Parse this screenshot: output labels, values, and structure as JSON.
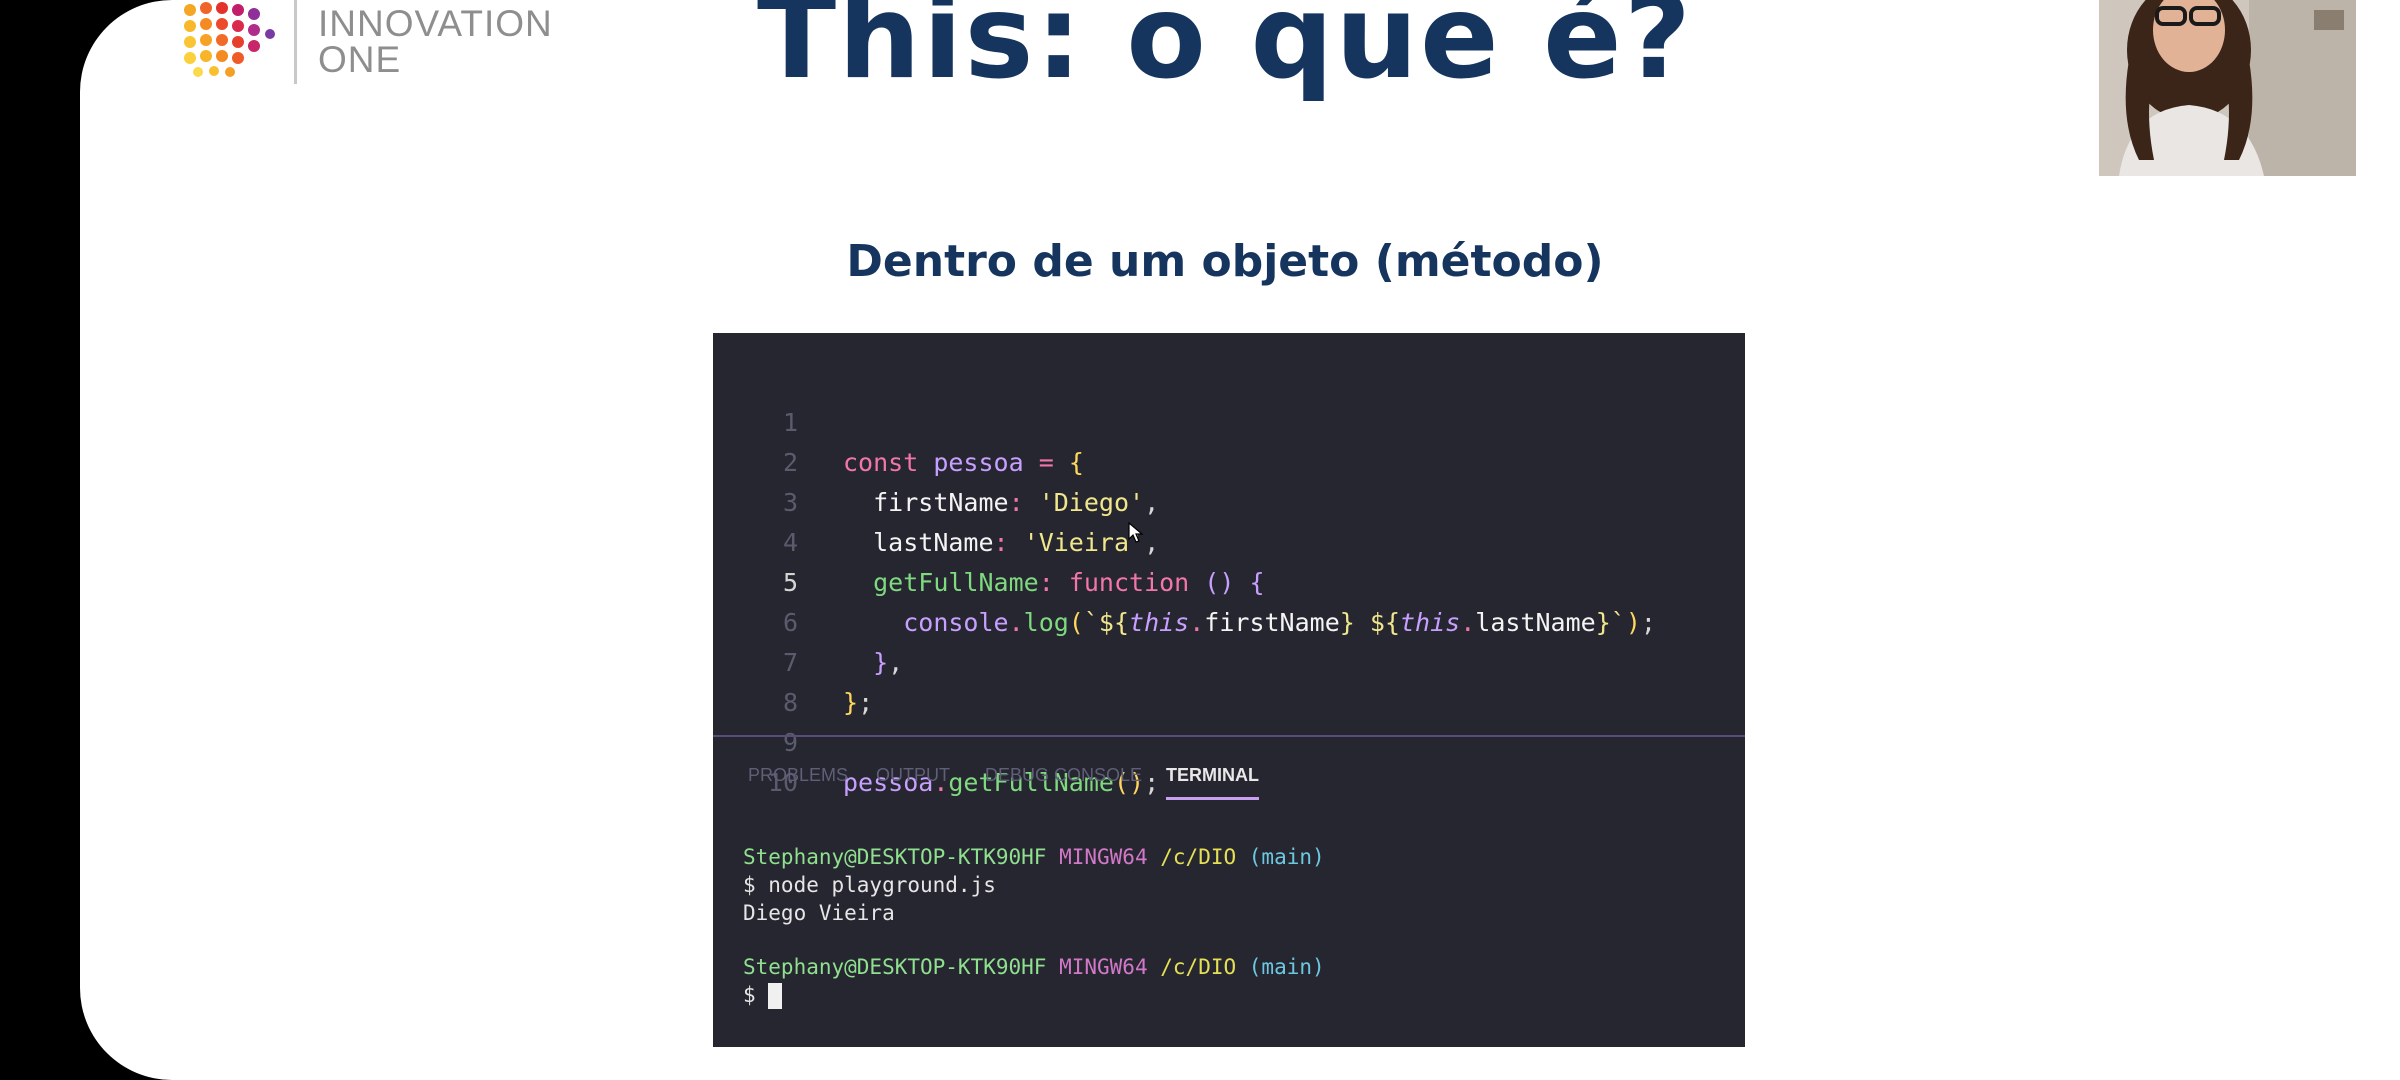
{
  "slide": {
    "title": "This: o que é?",
    "subtitle": "Dentro de um objeto (método)"
  },
  "logo": {
    "line1": "INNOVATION",
    "line2": "ONE"
  },
  "editor": {
    "lines": [
      {
        "n": "1",
        "code": "const pessoa = {"
      },
      {
        "n": "2",
        "code": "  firstName: 'Diego',"
      },
      {
        "n": "3",
        "code": "  lastName: 'Vieira',"
      },
      {
        "n": "4",
        "code": "  getFullName: function () {"
      },
      {
        "n": "5",
        "code": "    console.log(`${this.firstName} ${this.lastName}`);"
      },
      {
        "n": "6",
        "code": "  },"
      },
      {
        "n": "7",
        "code": "};"
      },
      {
        "n": "8",
        "code": ""
      },
      {
        "n": "9",
        "code": "pessoa.getFullName();"
      },
      {
        "n": "10",
        "code": ""
      }
    ],
    "active_line": "5",
    "tabs": [
      "PROBLEMS",
      "OUTPUT",
      "DEBUG CONSOLE",
      "TERMINAL"
    ],
    "active_tab": "TERMINAL"
  },
  "terminal": {
    "user": "Stephany@DESKTOP-KTK90HF",
    "system": "MINGW64",
    "path": "/c/DIO",
    "branch": "(main)",
    "command": "$ node playground.js",
    "output": "Diego Vieira",
    "prompt": "$"
  },
  "colors": {
    "title": "#16355e",
    "editor_bg": "#262630",
    "keyword": "#f276a9",
    "variable": "#c7a0ff",
    "string": "#f0e68c"
  }
}
